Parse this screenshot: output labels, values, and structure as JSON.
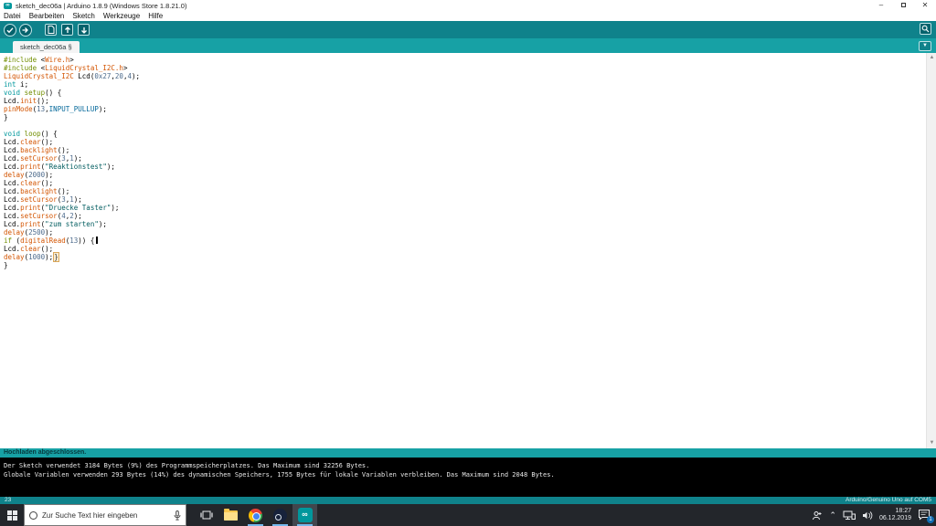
{
  "window": {
    "title": "sketch_dec06a | Arduino 1.8.9 (Windows Store 1.8.21.0)",
    "app_icon_glyph": "∞",
    "controls": {
      "minimize": "–",
      "close": "✕"
    }
  },
  "menu": {
    "items": [
      "Datei",
      "Bearbeiten",
      "Sketch",
      "Werkzeuge",
      "Hilfe"
    ]
  },
  "toolbar": {
    "buttons": [
      "verify",
      "upload",
      "new",
      "open",
      "save",
      "serial-monitor"
    ]
  },
  "tab": {
    "label": "sketch_dec06a §",
    "menu_glyph": "▼"
  },
  "editor": {
    "accent_colors": {
      "keyword_type": "#00979C",
      "function": "#D35400",
      "structure": "#728E00",
      "string": "#005C5F",
      "literal": "#006699"
    },
    "lines": [
      [
        [
          "pre",
          "#include "
        ],
        [
          "plain",
          "<"
        ],
        [
          "incl",
          "Wire.h"
        ],
        [
          "plain",
          ">"
        ]
      ],
      [
        [
          "pre",
          "#include "
        ],
        [
          "plain",
          "<"
        ],
        [
          "incl",
          "LiquidCrystal_I2C.h"
        ],
        [
          "plain",
          ">"
        ]
      ],
      [
        [
          "incl",
          "LiquidCrystal_I2C"
        ],
        [
          "plain",
          " Lcd("
        ],
        [
          "num",
          "0x27"
        ],
        [
          "plain",
          ","
        ],
        [
          "num",
          "20"
        ],
        [
          "plain",
          ","
        ],
        [
          "num",
          "4"
        ],
        [
          "plain",
          ");"
        ]
      ],
      [
        [
          "type",
          "int"
        ],
        [
          "plain",
          " i;"
        ]
      ],
      [
        [
          "type",
          "void"
        ],
        [
          "plain",
          " "
        ],
        [
          "ctrl",
          "setup"
        ],
        [
          "plain",
          "() {"
        ]
      ],
      [
        [
          "plain",
          "Lcd."
        ],
        [
          "func",
          "init"
        ],
        [
          "plain",
          "();"
        ]
      ],
      [
        [
          "func",
          "pinMode"
        ],
        [
          "plain",
          "("
        ],
        [
          "num",
          "13"
        ],
        [
          "plain",
          ","
        ],
        [
          "lit",
          "INPUT_PULLUP"
        ],
        [
          "plain",
          ");"
        ]
      ],
      [
        [
          "plain",
          "}"
        ]
      ],
      [],
      [
        [
          "type",
          "void"
        ],
        [
          "plain",
          " "
        ],
        [
          "ctrl",
          "loop"
        ],
        [
          "plain",
          "() {"
        ]
      ],
      [
        [
          "plain",
          "Lcd."
        ],
        [
          "func",
          "clear"
        ],
        [
          "plain",
          "();"
        ]
      ],
      [
        [
          "plain",
          "Lcd."
        ],
        [
          "func",
          "backlight"
        ],
        [
          "plain",
          "();"
        ]
      ],
      [
        [
          "plain",
          "Lcd."
        ],
        [
          "func",
          "setCursor"
        ],
        [
          "plain",
          "("
        ],
        [
          "num",
          "3"
        ],
        [
          "plain",
          ","
        ],
        [
          "num",
          "1"
        ],
        [
          "plain",
          ");"
        ]
      ],
      [
        [
          "plain",
          "Lcd."
        ],
        [
          "func",
          "print"
        ],
        [
          "plain",
          "("
        ],
        [
          "str",
          "\"Reaktionstest\""
        ],
        [
          "plain",
          ");"
        ]
      ],
      [
        [
          "func",
          "delay"
        ],
        [
          "plain",
          "("
        ],
        [
          "num",
          "2000"
        ],
        [
          "plain",
          ");"
        ]
      ],
      [
        [
          "plain",
          "Lcd."
        ],
        [
          "func",
          "clear"
        ],
        [
          "plain",
          "();"
        ]
      ],
      [
        [
          "plain",
          "Lcd."
        ],
        [
          "func",
          "backlight"
        ],
        [
          "plain",
          "();"
        ]
      ],
      [
        [
          "plain",
          "Lcd."
        ],
        [
          "func",
          "setCursor"
        ],
        [
          "plain",
          "("
        ],
        [
          "num",
          "3"
        ],
        [
          "plain",
          ","
        ],
        [
          "num",
          "1"
        ],
        [
          "plain",
          ");"
        ]
      ],
      [
        [
          "plain",
          "Lcd."
        ],
        [
          "func",
          "print"
        ],
        [
          "plain",
          "("
        ],
        [
          "str",
          "\"Druecke Taster\""
        ],
        [
          "plain",
          ");"
        ]
      ],
      [
        [
          "plain",
          "Lcd."
        ],
        [
          "func",
          "setCursor"
        ],
        [
          "plain",
          "("
        ],
        [
          "num",
          "4"
        ],
        [
          "plain",
          ","
        ],
        [
          "num",
          "2"
        ],
        [
          "plain",
          ");"
        ]
      ],
      [
        [
          "plain",
          "Lcd."
        ],
        [
          "func",
          "print"
        ],
        [
          "plain",
          "("
        ],
        [
          "str",
          "\"zum starten\""
        ],
        [
          "plain",
          ");"
        ]
      ],
      [
        [
          "func",
          "delay"
        ],
        [
          "plain",
          "("
        ],
        [
          "num",
          "2500"
        ],
        [
          "plain",
          ");"
        ]
      ],
      [
        [
          "ctrl",
          "if"
        ],
        [
          "plain",
          " ("
        ],
        [
          "func",
          "digitalRead"
        ],
        [
          "plain",
          "("
        ],
        [
          "num",
          "13"
        ],
        [
          "plain",
          ")) {"
        ],
        [
          "caret",
          ""
        ]
      ],
      [
        [
          "plain",
          "Lcd."
        ],
        [
          "func",
          "clear"
        ],
        [
          "plain",
          "();"
        ]
      ],
      [
        [
          "func",
          "delay"
        ],
        [
          "plain",
          "("
        ],
        [
          "num",
          "1000"
        ],
        [
          "plain",
          ");"
        ],
        [
          "brace",
          "}"
        ]
      ],
      [
        [
          "plain",
          "}"
        ]
      ]
    ],
    "scrollbar": {
      "up_glyph": "▲",
      "down_glyph": "▼"
    }
  },
  "status": {
    "message": "Hochladen abgeschlossen.",
    "bar_color": "#17a1a5"
  },
  "console": {
    "lines": [
      "Der Sketch verwendet 3184 Bytes (9%) des Programmspeicherplatzes. Das Maximum sind 32256 Bytes.",
      "Globale Variablen verwenden 293 Bytes (14%) des dynamischen Speichers, 1755 Bytes für lokale Variablen verbleiben. Das Maximum sind 2048 Bytes."
    ]
  },
  "footer": {
    "line_number": "23",
    "board_port": "Arduino/Genuino Uno auf COM5"
  },
  "taskbar": {
    "search_placeholder": "Zur Suche Text hier eingeben",
    "apps": [
      "task-view",
      "file-explorer",
      "chrome",
      "steam",
      "arduino"
    ],
    "arduino_glyph": "∞",
    "tray_chevron": "⌃",
    "clock": {
      "time": "18:27",
      "date": "06.12.2019"
    },
    "notification_count": "1"
  },
  "theme": {
    "teal_dark": "#0f828b",
    "teal_light": "#17a1a5",
    "console_bg": "#000000",
    "taskbar_bg": "#23262b"
  }
}
